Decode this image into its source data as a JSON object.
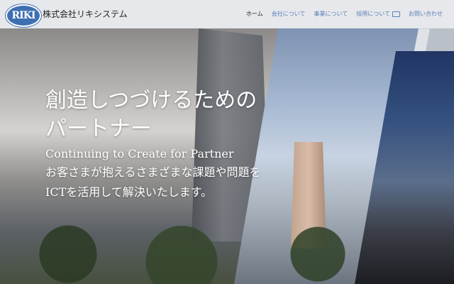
{
  "header": {
    "logo_text": "RIKI",
    "company_name": "株式会社リキシステム",
    "nav": [
      {
        "label": "ホーム",
        "active": true
      },
      {
        "label": "会社について",
        "active": false
      },
      {
        "label": "事業について",
        "active": false
      },
      {
        "label": "採用について",
        "active": false,
        "icon": "window-icon"
      },
      {
        "label": "お問い合わせ",
        "active": false
      }
    ]
  },
  "hero": {
    "headline_line1": "創造しつづけるための",
    "headline_line2": "パートナー",
    "subheadline": "Continuing to Create for Partner",
    "description_line1": "お客さまが抱えるさまざまな課題や問題を",
    "description_line2": "ICTを活用して解決いたします。"
  },
  "colors": {
    "accent": "#5b7fb6",
    "logo_blue": "#3e6fb0"
  }
}
